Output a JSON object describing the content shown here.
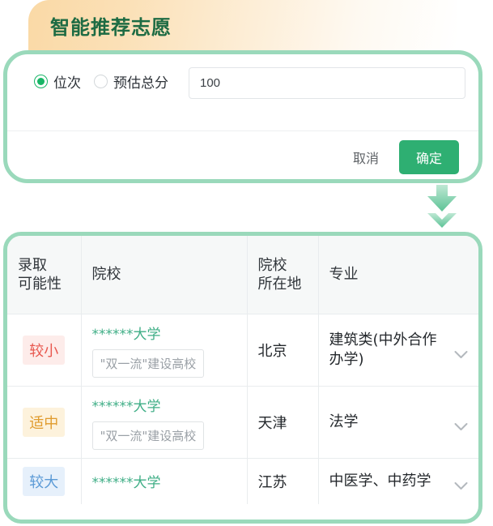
{
  "header": {
    "title": "智能推荐志愿"
  },
  "dialog": {
    "radios": [
      {
        "label": "位次",
        "checked": true
      },
      {
        "label": "预估总分",
        "checked": false
      }
    ],
    "score_input": {
      "value": "100",
      "placeholder": ""
    },
    "cancel_label": "取消",
    "confirm_label": "确定"
  },
  "arrow": {
    "icon": "arrow-down-double-icon"
  },
  "table": {
    "columns": [
      "录取可能性",
      "院校",
      "院校所在地",
      "专业"
    ],
    "column_lines": [
      [
        "录取",
        "可能性"
      ],
      [
        "院校"
      ],
      [
        "院校",
        "所在地"
      ],
      [
        "专业"
      ]
    ],
    "rows": [
      {
        "probability": "较小",
        "probability_style": "low",
        "school": "******大学",
        "school_tag": "\"双一流\"建设高校",
        "location": "北京",
        "major": "建筑类(中外合作办学)",
        "chevron": "chevron-down-icon"
      },
      {
        "probability": "适中",
        "probability_style": "mid",
        "school": "******大学",
        "school_tag": "\"双一流\"建设高校",
        "location": "天津",
        "major": "法学",
        "chevron": "chevron-down-icon"
      },
      {
        "probability": "较大",
        "probability_style": "high",
        "school": "******大学",
        "school_tag": "",
        "location": "江苏",
        "major": "中医学、中药学",
        "chevron": "chevron-down-icon"
      }
    ]
  },
  "colors": {
    "brand_green": "#2eaf72",
    "border_green": "#9ad9bb",
    "banner_orange": "#fad9a6",
    "title_green": "#1d6b43",
    "link_green": "#3fae86",
    "badge_low": "#e8584f",
    "badge_mid": "#e09b2d",
    "badge_high": "#5b9ad6"
  }
}
